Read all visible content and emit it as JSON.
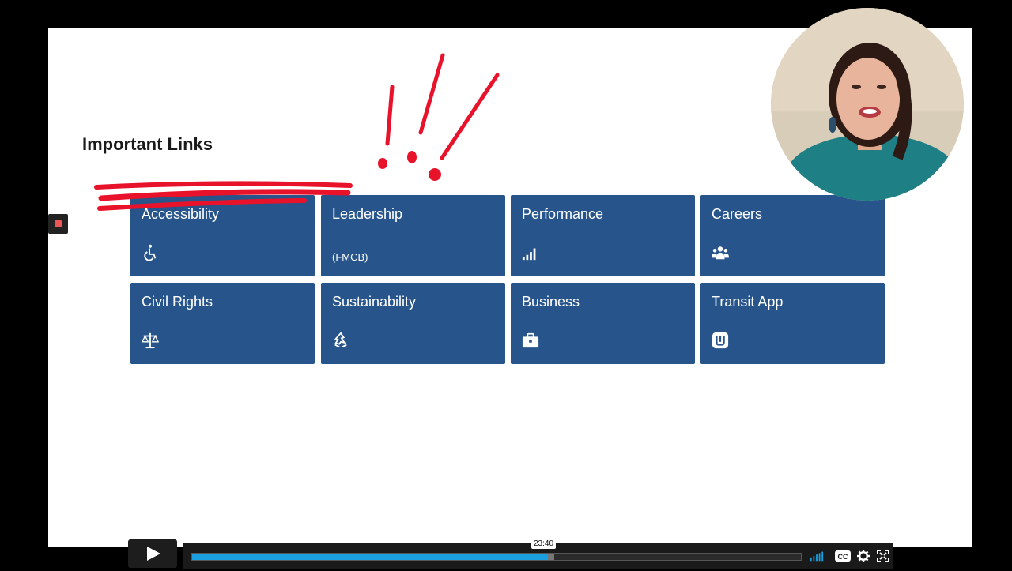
{
  "slide": {
    "section_title": "Important Links",
    "tiles": [
      {
        "title": "Accessibility",
        "subtitle": "",
        "icon": "wheelchair-icon"
      },
      {
        "title": "Leadership",
        "subtitle": "(FMCB)",
        "icon": ""
      },
      {
        "title": "Performance",
        "subtitle": "",
        "icon": "signal-bars-icon"
      },
      {
        "title": "Careers",
        "subtitle": "",
        "icon": "users-icon"
      },
      {
        "title": "Civil Rights",
        "subtitle": "",
        "icon": "balance-scale-icon"
      },
      {
        "title": "Sustainability",
        "subtitle": "",
        "icon": "recycle-icon"
      },
      {
        "title": "Business",
        "subtitle": "",
        "icon": "briefcase-icon"
      },
      {
        "title": "Transit App",
        "subtitle": "",
        "icon": "transit-app-icon"
      }
    ],
    "tile_color": "#27548a",
    "annotation_color": "#e8132b"
  },
  "player": {
    "hover_time": "23:40",
    "progress_fraction": 0.585,
    "buffered_fraction": 0.595,
    "played_color": "#1a9fe0",
    "controls": [
      "play-icon",
      "volume-icon",
      "closed-captions-icon",
      "settings-gear-icon",
      "fullscreen-icon"
    ],
    "cc_label": "CC"
  }
}
